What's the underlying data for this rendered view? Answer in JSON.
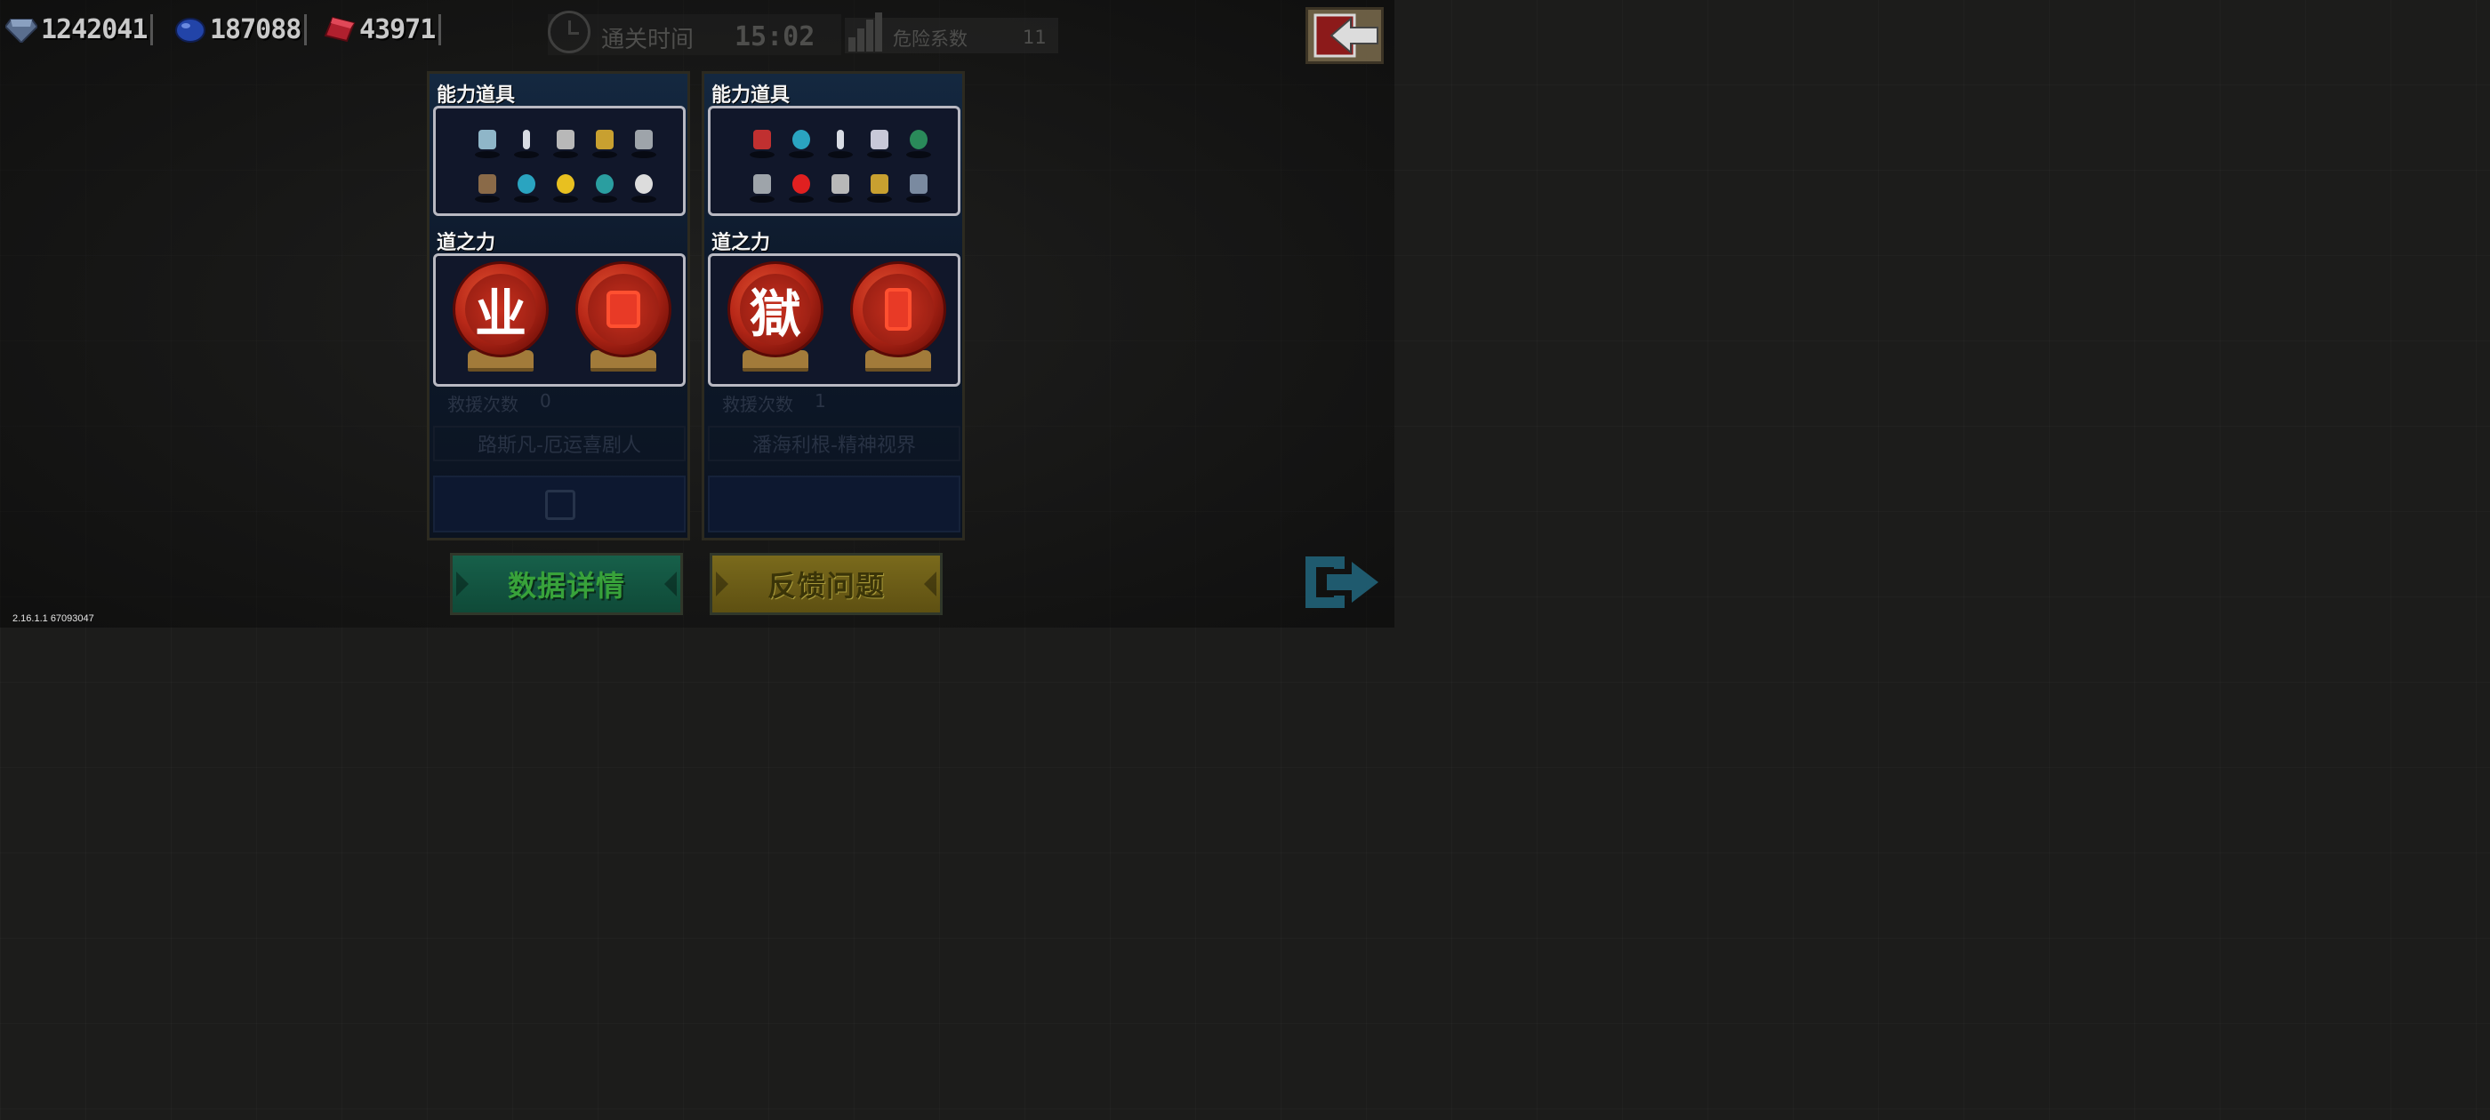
{
  "currencies": [
    {
      "icon": "diamond-icon",
      "value": "1242041",
      "color": "#5a6e8e"
    },
    {
      "icon": "blue-gem-icon",
      "value": "187088",
      "color": "#2244a8"
    },
    {
      "icon": "red-gem-icon",
      "value": "43971",
      "color": "#b0202e"
    }
  ],
  "run": {
    "time_label": "通关时间",
    "time_value": "15:02",
    "danger_label": "危险系数",
    "danger_value": "11"
  },
  "players": [
    {
      "items_title": "能力道具",
      "power_title": "道之力",
      "items": [
        {
          "name": "axe",
          "color": "#8fb6c8"
        },
        {
          "name": "dagger",
          "color": "#d8dce4"
        },
        {
          "name": "cleaver",
          "color": "#b8b8b8"
        },
        {
          "name": "golden-gauntlet",
          "color": "#c8a030"
        },
        {
          "name": "claws",
          "color": "#9ea4aa"
        },
        {
          "name": "horn",
          "color": "#8a6a48"
        },
        {
          "name": "amulet",
          "color": "#2aa4c0"
        },
        {
          "name": "gold-coin",
          "color": "#e8c020"
        },
        {
          "name": "stopwatch",
          "color": "#2a9ea0"
        },
        {
          "name": "skull-mask",
          "color": "#dcdcdc"
        }
      ],
      "powers": [
        {
          "glyph": "业",
          "icon": "karma-orb-icon"
        },
        {
          "glyph": "",
          "icon": "crimson-glyph-orb-icon"
        }
      ],
      "rescue_label": "救援次数",
      "rescue_value": "0",
      "name": "路斯凡-厄运喜剧人"
    },
    {
      "items_title": "能力道具",
      "power_title": "道之力",
      "items": [
        {
          "name": "drum",
          "color": "#c03030"
        },
        {
          "name": "amulet",
          "color": "#2aa4c0"
        },
        {
          "name": "dagger",
          "color": "#d8dce4"
        },
        {
          "name": "drone",
          "color": "#c8c8d8"
        },
        {
          "name": "green-pot",
          "color": "#2a8a5a"
        },
        {
          "name": "claws",
          "color": "#9ea4aa"
        },
        {
          "name": "red-bomb",
          "color": "#e02020"
        },
        {
          "name": "cleaver",
          "color": "#b8b8b8"
        },
        {
          "name": "golden-gauntlet",
          "color": "#c8a030"
        },
        {
          "name": "sickle",
          "color": "#7a8aa0"
        }
      ],
      "powers": [
        {
          "glyph": "獄",
          "icon": "prison-orb-icon"
        },
        {
          "glyph": "",
          "icon": "totem-orb-icon"
        }
      ],
      "rescue_label": "救援次数",
      "rescue_value": "1",
      "name": "潘海利根-精神视界"
    }
  ],
  "buttons": {
    "details": "数据详情",
    "feedback": "反馈问题"
  },
  "version": "2.16.1.1 67093047"
}
